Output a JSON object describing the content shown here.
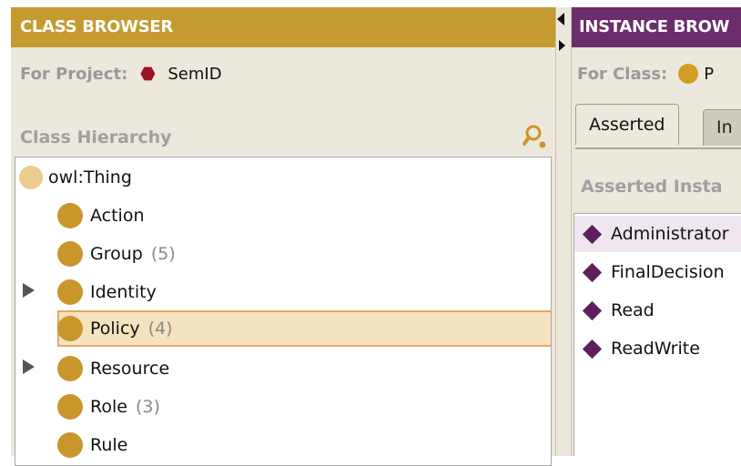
{
  "class_browser": {
    "header": "CLASS BROWSER",
    "project_label": "For Project:",
    "project_name": "SemID",
    "hierarchy_label": "Class Hierarchy",
    "tree": [
      {
        "label": "owl:Thing",
        "count": ""
      },
      {
        "label": "Action",
        "count": ""
      },
      {
        "label": "Group",
        "count": "(5)"
      },
      {
        "label": "Identity",
        "count": ""
      },
      {
        "label": "Policy",
        "count": "(4)"
      },
      {
        "label": "Resource",
        "count": ""
      },
      {
        "label": "Role",
        "count": "(3)"
      },
      {
        "label": "Rule",
        "count": ""
      }
    ]
  },
  "instance_browser": {
    "header": "INSTANCE BROW",
    "class_label": "For Class:",
    "class_name_partial": "P",
    "tabs": [
      "Asserted",
      "In"
    ],
    "asserted_label": "Asserted Insta",
    "instances": [
      "Administrator",
      "FinalDecision",
      "Read",
      "ReadWrite"
    ]
  },
  "colors": {
    "class_header": "#c59a2f",
    "instance_header": "#6b2d6b",
    "class_ball": "#c8962a",
    "project_hex": "#9a1424",
    "instance_diamond": "#5e1f5e",
    "selection_fill": "#f5e2bf",
    "selection_border": "#e2a866"
  }
}
